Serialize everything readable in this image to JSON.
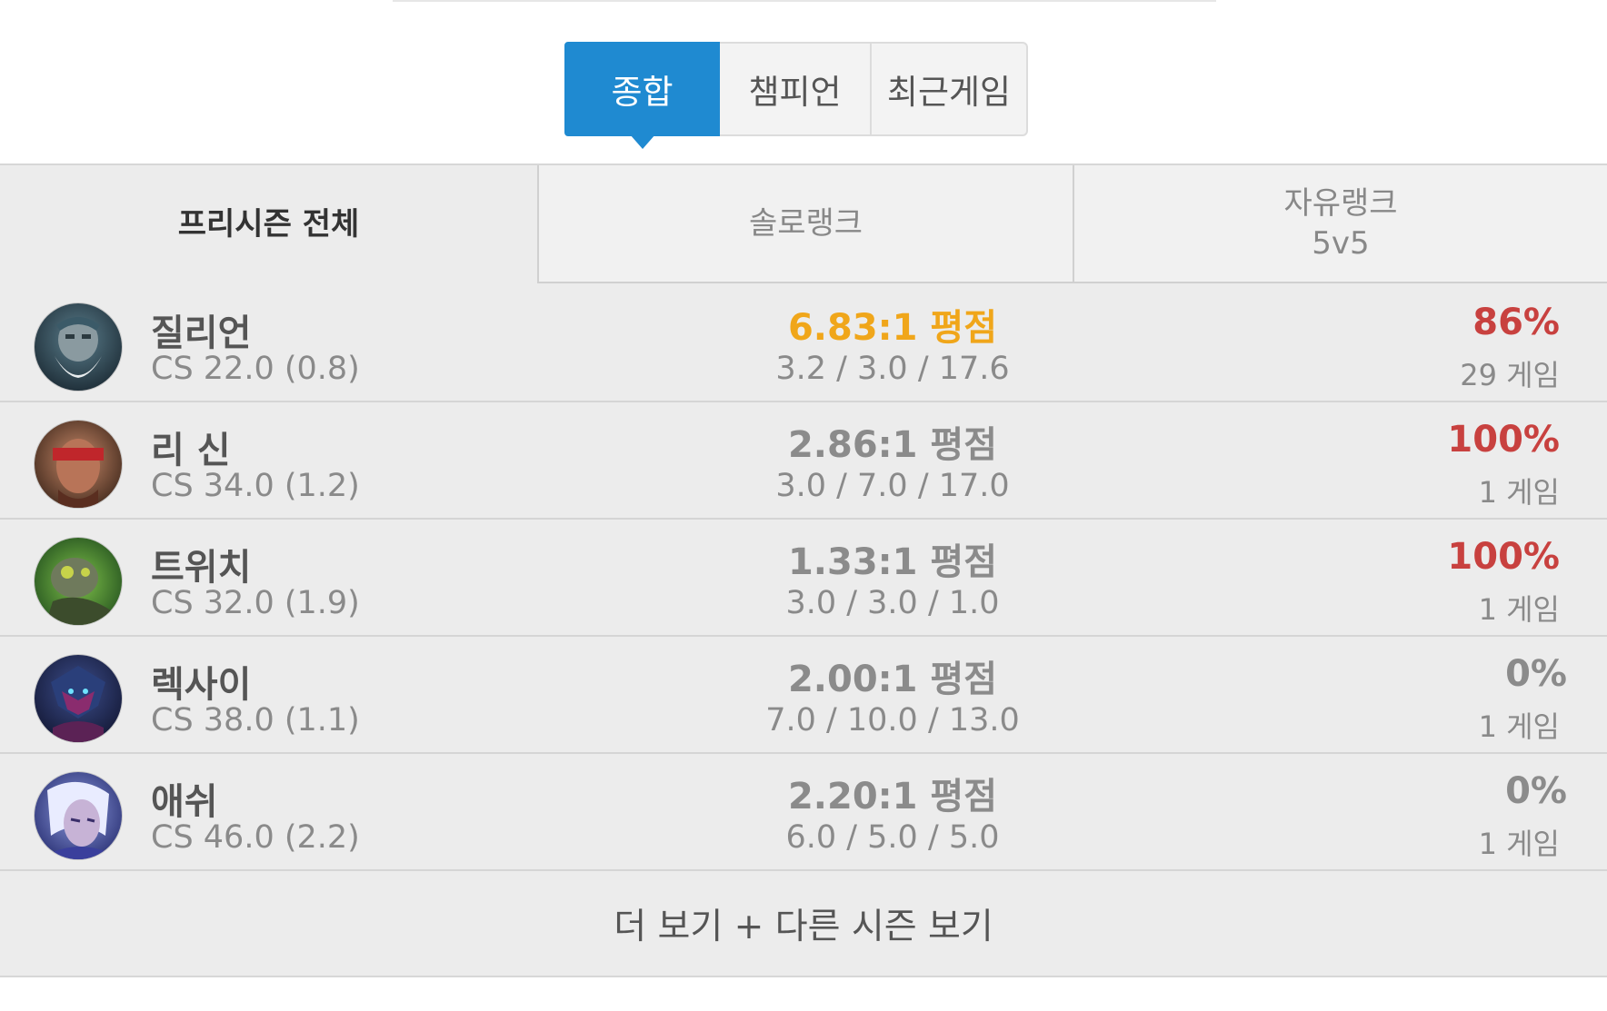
{
  "tabs": [
    {
      "label": "종합",
      "active": true
    },
    {
      "label": "챔피언",
      "active": false
    },
    {
      "label": "최근게임",
      "active": false
    }
  ],
  "filters": {
    "all": "프리시즌 전체",
    "solo": "솔로랭크",
    "flex_line1": "자유랭크",
    "flex_line2": "5v5"
  },
  "champions": [
    {
      "name": "질리언",
      "cs": "CS 22.0 (0.8)",
      "kda_ratio": "6.83:1 평점",
      "kda": "3.2 / 3.0 / 17.6",
      "winrate": "86%",
      "games": "29 게임",
      "avatar_icon": "zilean-portrait"
    },
    {
      "name": "리 신",
      "cs": "CS 34.0 (1.2)",
      "kda_ratio": "2.86:1 평점",
      "kda": "3.0 / 7.0 / 17.0",
      "winrate": "100%",
      "games": "1 게임",
      "avatar_icon": "lee-sin-portrait"
    },
    {
      "name": "트위치",
      "cs": "CS 32.0 (1.9)",
      "kda_ratio": "1.33:1 평점",
      "kda": "3.0 / 3.0 / 1.0",
      "winrate": "100%",
      "games": "1 게임",
      "avatar_icon": "twitch-portrait"
    },
    {
      "name": "렉사이",
      "cs": "CS 38.0 (1.1)",
      "kda_ratio": "2.00:1 평점",
      "kda": "7.0 / 10.0 / 13.0",
      "winrate": "0%",
      "games": "1 게임",
      "avatar_icon": "reksai-portrait"
    },
    {
      "name": "애쉬",
      "cs": "CS 46.0 (2.2)",
      "kda_ratio": "2.20:1 평점",
      "kda": "6.0 / 5.0 / 5.0",
      "winrate": "0%",
      "games": "1 게임",
      "avatar_icon": "ashe-portrait"
    }
  ],
  "more_label": "더 보기 + 다른 시즌 보기",
  "colors": {
    "accent": "#1f8ad1",
    "kda_highlight": "#f0a61a",
    "winrate_high": "#c8413f",
    "muted": "#8b8b8b"
  }
}
